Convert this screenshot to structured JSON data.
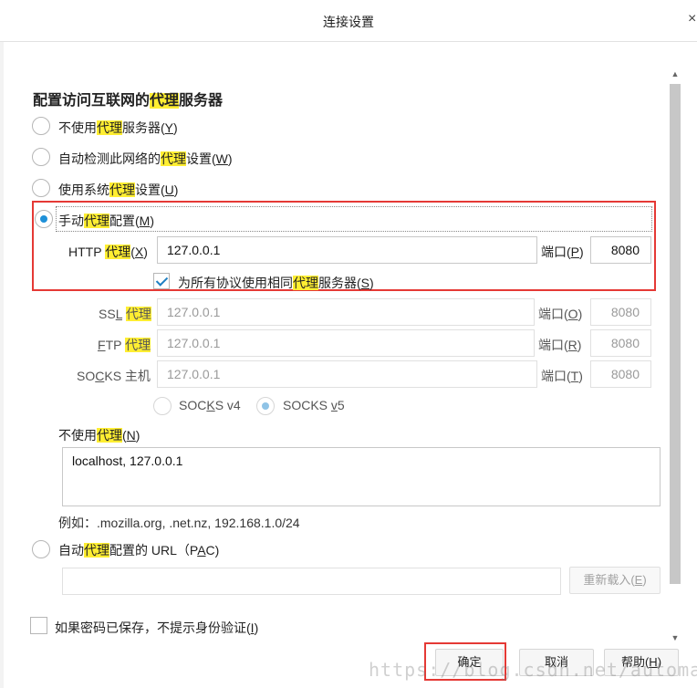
{
  "dialog": {
    "title": "连接设置",
    "close_glyph": "×"
  },
  "heading": {
    "pre": "配置访问互联网的",
    "hl": "代理",
    "post": "服务器"
  },
  "options": {
    "no_proxy": {
      "pre": "不使用",
      "hl": "代理",
      "post": "服务器(",
      "key": "Y",
      "end": ")",
      "selected": false
    },
    "auto_detect": {
      "pre": "自动检测此网络的",
      "hl": "代理",
      "post": "设置(",
      "key": "W",
      "end": ")",
      "selected": false
    },
    "system": {
      "pre": "使用系统",
      "hl": "代理",
      "post": "设置(",
      "key": "U",
      "end": ")",
      "selected": false
    },
    "manual": {
      "pre": "手动",
      "hl": "代理",
      "post": "配置(",
      "key": "M",
      "end": ")",
      "selected": true
    }
  },
  "http": {
    "label_pre": "HTTP ",
    "label_hl": "代理",
    "label_post": "(",
    "label_key": "X",
    "label_end": ")",
    "value": "127.0.0.1",
    "port_label_pre": "端口(",
    "port_key": "P",
    "port_end": ")",
    "port": "8080"
  },
  "same_proxy": {
    "pre": "为所有协议使用相同",
    "hl": "代理",
    "post": "服务器(",
    "key": "S",
    "end": ")",
    "checked": true
  },
  "ssl": {
    "label_pre": "SS",
    "label_key": "L",
    "label_space": " ",
    "label_hl": "代理",
    "value": "127.0.0.1",
    "port_label_pre": "端口(",
    "port_key": "O",
    "port_end": ")",
    "port": "8080"
  },
  "ftp": {
    "label_key": "F",
    "label_rest": "TP ",
    "label_hl": "代理",
    "value": "127.0.0.1",
    "port_label_pre": "端口(",
    "port_key": "R",
    "port_end": ")",
    "port": "8080"
  },
  "socks": {
    "label_pre": "SO",
    "label_key": "C",
    "label_post": "KS 主机",
    "value": "127.0.0.1",
    "port_label_pre": "端口(",
    "port_key": "T",
    "port_end": ")",
    "port": "8080",
    "v4_pre": "SOC",
    "v4_key": "K",
    "v4_post": "S v4",
    "v4_selected": false,
    "v5_pre": "SOCKS ",
    "v5_key": "v",
    "v5_post": "5",
    "v5_selected": true
  },
  "no_proxy_for": {
    "label_pre": "不使用",
    "label_hl": "代理",
    "label_post": "(",
    "label_key": "N",
    "label_end": ")",
    "value": "localhost, 127.0.0.1",
    "example": "例如：.mozilla.org, .net.nz, 192.168.1.0/24"
  },
  "pac": {
    "pre": "自动",
    "hl": "代理",
    "post": "配置的 URL（P",
    "key": "A",
    "end": "C)",
    "selected": false,
    "value": "",
    "reload_pre": "重新载入(",
    "reload_key": "E",
    "reload_end": ")"
  },
  "no_prompt_auth": {
    "pre": "如果密码已保存，不提示身份验证(",
    "key": "I",
    "end": ")",
    "checked": false
  },
  "buttons": {
    "ok": "确定",
    "cancel": "取消",
    "help_pre": "帮助(",
    "help_key": "H",
    "help_end": ")"
  },
  "scrollbar": {
    "up_icon": "▲",
    "down_icon": "▼"
  },
  "watermark": "https://blog.csdn.net/automationwei",
  "colors": {
    "highlight": "#ffee32",
    "annotation_red": "#e53935",
    "accent_blue": "#1e90d8"
  }
}
